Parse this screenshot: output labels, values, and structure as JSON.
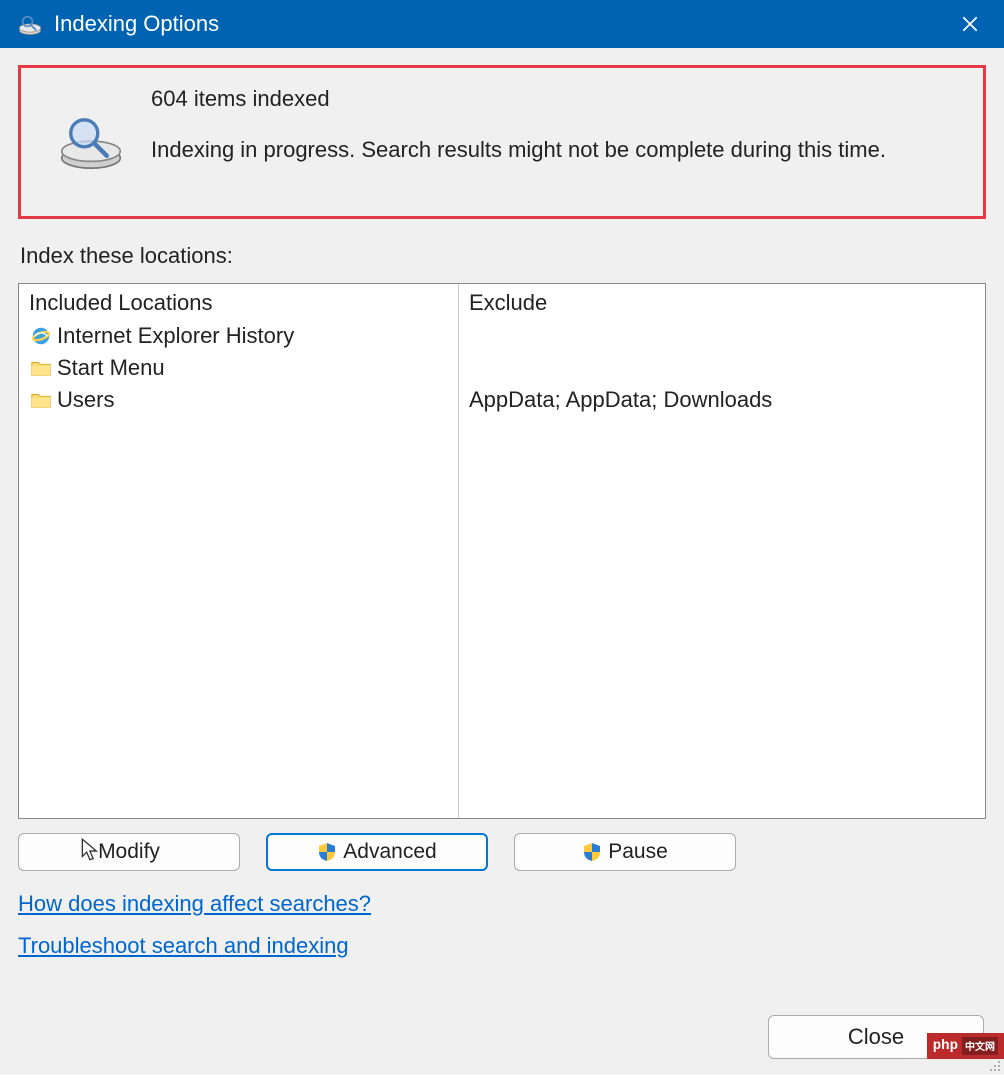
{
  "window": {
    "title": "Indexing Options"
  },
  "status": {
    "count_text": "604 items indexed",
    "message": "Indexing in progress. Search results might not be complete during this time."
  },
  "section_label": "Index these locations:",
  "columns": {
    "included_header": "Included Locations",
    "exclude_header": "Exclude"
  },
  "locations": [
    {
      "icon": "ie-icon",
      "label": "Internet Explorer History",
      "exclude": ""
    },
    {
      "icon": "folder-icon",
      "label": "Start Menu",
      "exclude": ""
    },
    {
      "icon": "folder-icon",
      "label": "Users",
      "exclude": "AppData; AppData; Downloads"
    }
  ],
  "buttons": {
    "modify": "Modify",
    "advanced": "Advanced",
    "pause": "Pause",
    "close": "Close"
  },
  "links": {
    "help": "How does indexing affect searches?",
    "troubleshoot": "Troubleshoot search and indexing"
  },
  "watermark": "php"
}
